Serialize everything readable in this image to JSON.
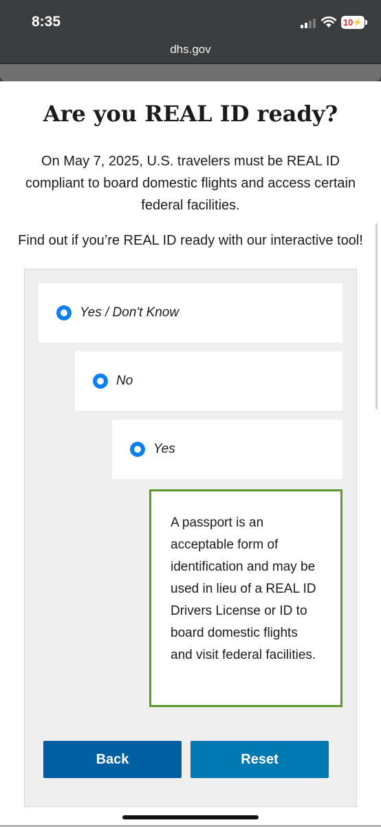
{
  "status_bar": {
    "time": "8:35",
    "battery": "10",
    "icons": [
      "cellular-signal-icon",
      "wifi-icon",
      "battery-charging-icon"
    ]
  },
  "browser": {
    "url": "dhs.gov"
  },
  "page": {
    "title": "Are you REAL ID ready?",
    "intro": "On May 7, 2025, U.S. travelers must be REAL ID compliant to board domestic flights and access certain federal facilities.",
    "cta": "Find out if you’re REAL ID ready with our interactive tool!"
  },
  "tool": {
    "options": [
      {
        "label": "Yes / Don't Know",
        "selected": true
      },
      {
        "label": "No",
        "selected": true
      },
      {
        "label": "Yes",
        "selected": true
      }
    ],
    "result_text": "A passport is an acceptable form of identification and may be used in lieu of a REAL ID Drivers License or ID to board domestic flights and visit federal facilities.",
    "back_label": "Back",
    "reset_label": "Reset"
  },
  "colors": {
    "chrome": "#3a3c3e",
    "radio": "#0b7ef2",
    "result_border": "#5a9a2c",
    "back_button": "#005ea2",
    "reset_button": "#0079b3"
  }
}
